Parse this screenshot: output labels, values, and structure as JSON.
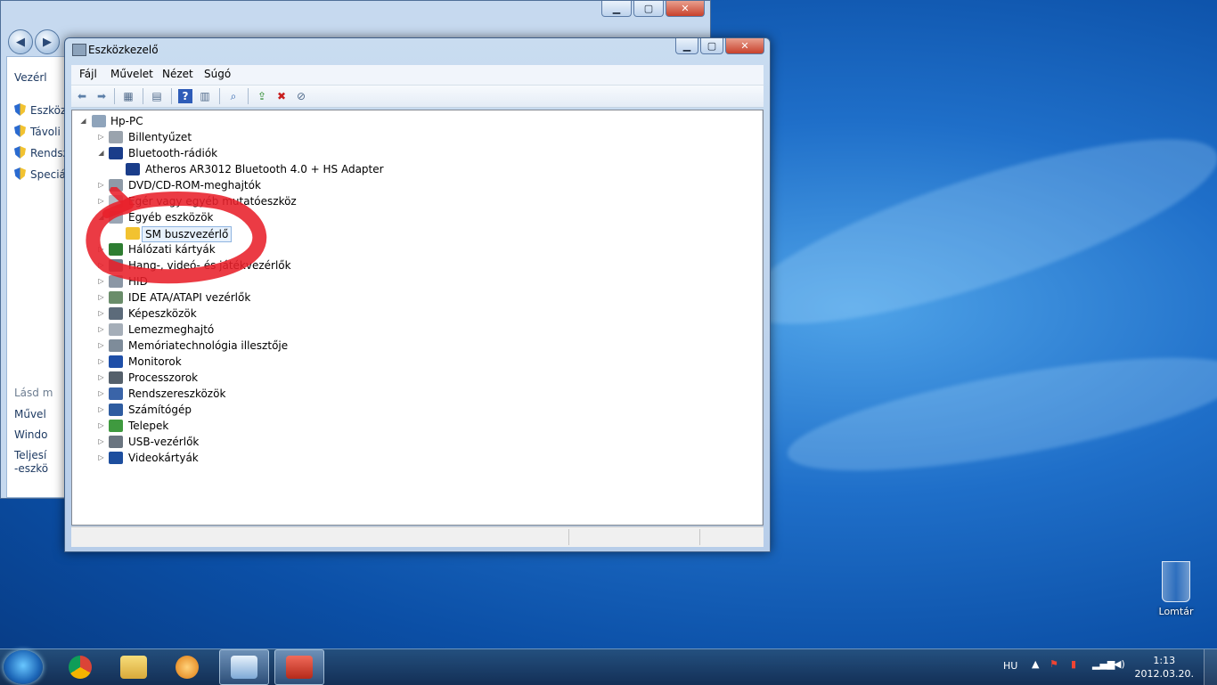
{
  "back_window": {
    "sidebar_items": [
      {
        "label": "Eszköz",
        "icon": "shield-icon"
      },
      {
        "label": "Távoli",
        "icon": "shield-icon"
      },
      {
        "label": "Rendsz",
        "icon": "shield-icon"
      },
      {
        "label": "Speciá",
        "icon": "shield-icon"
      }
    ],
    "top_label": "Vezérl",
    "see_also": "Lásd m",
    "links": [
      "Művel",
      "Windo",
      "Teljesí",
      "-eszkö"
    ]
  },
  "device_manager": {
    "title": "Eszközkezelő",
    "menu": [
      "Fájl",
      "Művelet",
      "Nézet",
      "Súgó"
    ],
    "tree": {
      "root": "Hp-PC",
      "nodes": [
        {
          "label": "Billentyűzet",
          "expanded": false,
          "icon": "keyboard-icon"
        },
        {
          "label": "Bluetooth-rádiók",
          "expanded": true,
          "icon": "bluetooth-icon"
        },
        {
          "label": "Atheros AR3012 Bluetooth 4.0 + HS Adapter",
          "child": true,
          "icon": "bluetooth-icon"
        },
        {
          "label": "DVD/CD-ROM-meghajtók",
          "expanded": false,
          "icon": "dvd-drive-icon"
        },
        {
          "label": "Egér vagy egyéb mutatóeszköz",
          "expanded": false,
          "icon": "mouse-icon"
        },
        {
          "label": "Egyéb eszközök",
          "expanded": true,
          "icon": "unknown-device-icon"
        },
        {
          "label": "SM buszvezérlő",
          "child": true,
          "selected": true,
          "icon": "warning-device-icon"
        },
        {
          "label": "Hálózati kártyák",
          "expanded": false,
          "icon": "network-adapter-icon"
        },
        {
          "label": "Hang-, videó- és játékvezérlők",
          "expanded": false,
          "icon": "sound-icon"
        },
        {
          "label": "HID",
          "expanded": false,
          "icon": "hid-icon"
        },
        {
          "label": "IDE ATA/ATAPI vezérlők",
          "expanded": false,
          "icon": "ide-controller-icon"
        },
        {
          "label": "Képeszközök",
          "expanded": false,
          "icon": "camera-icon"
        },
        {
          "label": "Lemezmeghajtó",
          "expanded": false,
          "icon": "disk-drive-icon"
        },
        {
          "label": "Memóriatechnológia illesztője",
          "expanded": false,
          "icon": "memory-icon"
        },
        {
          "label": "Monitorok",
          "expanded": false,
          "icon": "monitor-icon"
        },
        {
          "label": "Processzorok",
          "expanded": false,
          "icon": "processor-icon"
        },
        {
          "label": "Rendszereszközök",
          "expanded": false,
          "icon": "system-device-icon"
        },
        {
          "label": "Számítógép",
          "expanded": false,
          "icon": "computer-icon"
        },
        {
          "label": "Telepek",
          "expanded": false,
          "icon": "battery-icon"
        },
        {
          "label": "USB-vezérlők",
          "expanded": false,
          "icon": "usb-icon"
        },
        {
          "label": "Videokártyák",
          "expanded": false,
          "icon": "display-adapter-icon"
        }
      ]
    }
  },
  "desktop": {
    "recycle_bin": "Lomtár"
  },
  "taskbar": {
    "language": "HU",
    "time": "1:13",
    "date": "2012.03.20.",
    "apps": [
      "chrome-icon",
      "explorer-icon",
      "media-player-icon",
      "control-panel-icon",
      "device-manager-icon"
    ]
  },
  "colors": {
    "annotation": "#e8202a",
    "selection": "#e7f1fc",
    "accent": "#1f6fc9"
  }
}
